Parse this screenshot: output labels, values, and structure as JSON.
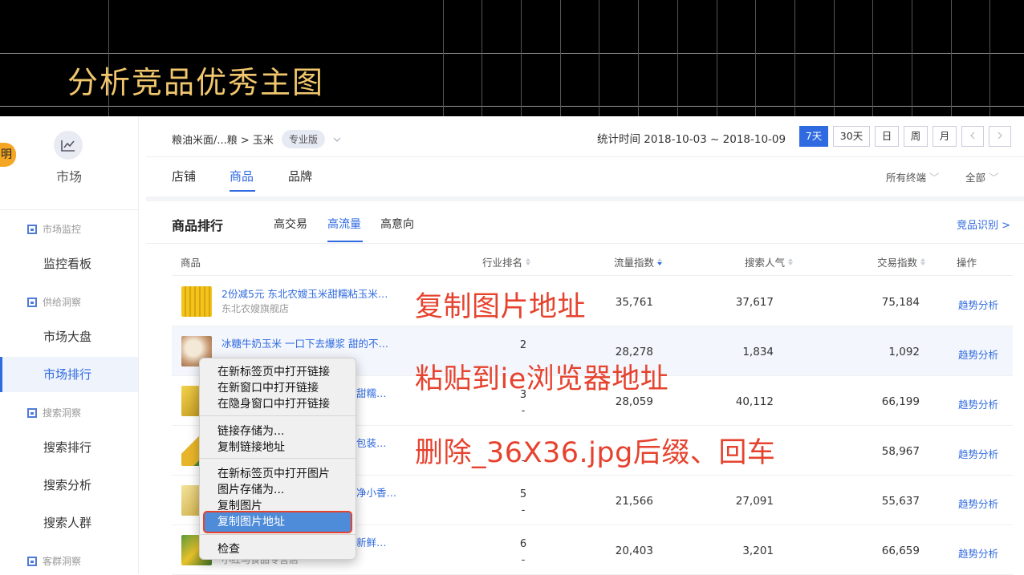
{
  "banner": {
    "title": "分析竞品优秀主图"
  },
  "sidebar": {
    "badge": "明",
    "market_label": "市场",
    "sections": [
      {
        "label": "市场监控"
      },
      {
        "label": "供给洞察"
      },
      {
        "label": "搜索洞察"
      },
      {
        "label": "客群洞察"
      }
    ],
    "items": [
      {
        "label": "监控看板"
      },
      {
        "label": "市场大盘"
      },
      {
        "label": "市场排行"
      },
      {
        "label": "搜索排行"
      },
      {
        "label": "搜索分析"
      },
      {
        "label": "搜索人群"
      }
    ],
    "active_item": "市场排行"
  },
  "topbar": {
    "breadcrumb": "粮油米面/...粮 > 玉米",
    "edition": "专业版",
    "stat_time": "统计时间 2018-10-03 ~ 2018-10-09",
    "periods": [
      "7天",
      "30天",
      "日",
      "周",
      "月"
    ],
    "active_period": "7天",
    "tabs": [
      "店铺",
      "商品",
      "品牌"
    ],
    "active_tab": "商品",
    "filters": [
      "所有终端",
      "全部"
    ]
  },
  "ranking": {
    "title": "商品排行",
    "subtabs": [
      "高交易",
      "高流量",
      "高意向"
    ],
    "active_subtab": "高流量",
    "competitor_link": "竞品识别 >",
    "headers": {
      "product": "商品",
      "rank": "行业排名",
      "traffic": "流量指数",
      "search": "搜索人气",
      "trade": "交易指数",
      "action": "操作"
    },
    "rows": [
      {
        "name": "2份减5元 东北农嫂玉米甜糯粘玉米…",
        "shop": "东北农嫂旗舰店",
        "rank": "",
        "rank_change": "",
        "traffic": "35,761",
        "search": "37,617",
        "trade": "75,184",
        "action": "趋势分析"
      },
      {
        "name": "冰糖牛奶玉米 一口下去爆浆 甜的不…",
        "shop": "",
        "rank": "2",
        "rank_change": "",
        "traffic": "28,278",
        "search": "1,834",
        "trade": "1,092",
        "action": "趋势分析"
      },
      {
        "name": "甜糯…",
        "shop": "",
        "rank": "3",
        "rank_change": "-",
        "traffic": "28,059",
        "search": "40,112",
        "trade": "66,199",
        "action": "趋势分析"
      },
      {
        "name": "包装…",
        "shop": "",
        "rank": "",
        "rank_change": "-",
        "traffic": "",
        "search": "",
        "trade": "58,967",
        "action": "趋势分析"
      },
      {
        "name": "净小香…",
        "shop": "",
        "rank": "5",
        "rank_change": "-",
        "traffic": "21,566",
        "search": "27,091",
        "trade": "55,637",
        "action": "趋势分析"
      },
      {
        "name": "新鲜…",
        "shop": "小红马食品专营店",
        "rank": "6",
        "rank_change": "-",
        "traffic": "20,403",
        "search": "3,201",
        "trade": "66,659",
        "action": "趋势分析"
      }
    ]
  },
  "annotations": {
    "step1": "复制图片地址",
    "step2": "粘贴到ie浏览器地址",
    "step3": "删除_36X36.jpg后缀、回车"
  },
  "context_menu": {
    "group1": [
      "在新标签页中打开链接",
      "在新窗口中打开链接",
      "在隐身窗口中打开链接"
    ],
    "group2": [
      "链接存储为...",
      "复制链接地址"
    ],
    "group3": [
      "在新标签页中打开图片",
      "图片存储为...",
      "复制图片",
      "复制图片地址"
    ],
    "group4": [
      "检查"
    ],
    "highlighted": "复制图片地址"
  },
  "colors": {
    "accent": "#2f6ae0",
    "banner_title": "#f1c66d",
    "annotation": "#e6432f",
    "banner_bg": "#000000"
  }
}
